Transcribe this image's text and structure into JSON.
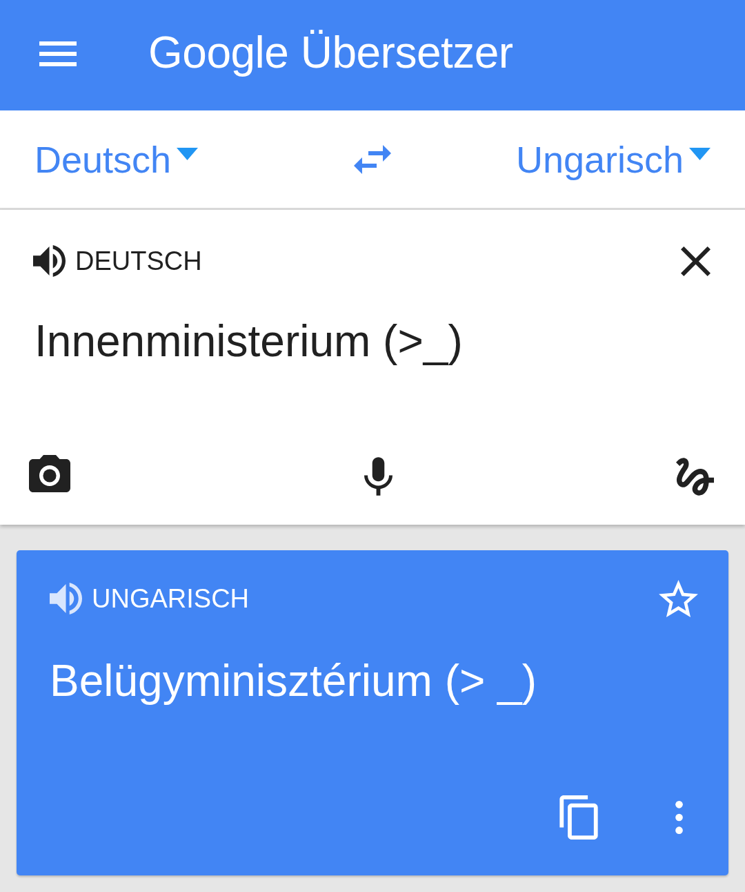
{
  "app_bar": {
    "title": "Google Übersetzer"
  },
  "language_bar": {
    "source_language": "Deutsch",
    "target_language": "Ungarisch"
  },
  "input_panel": {
    "language_label": "DEUTSCH",
    "text": "Innenministerium (>_)"
  },
  "result_card": {
    "language_label": "UNGARISCH",
    "text": "Belügyminisztérium (> _)",
    "starred": false
  }
}
